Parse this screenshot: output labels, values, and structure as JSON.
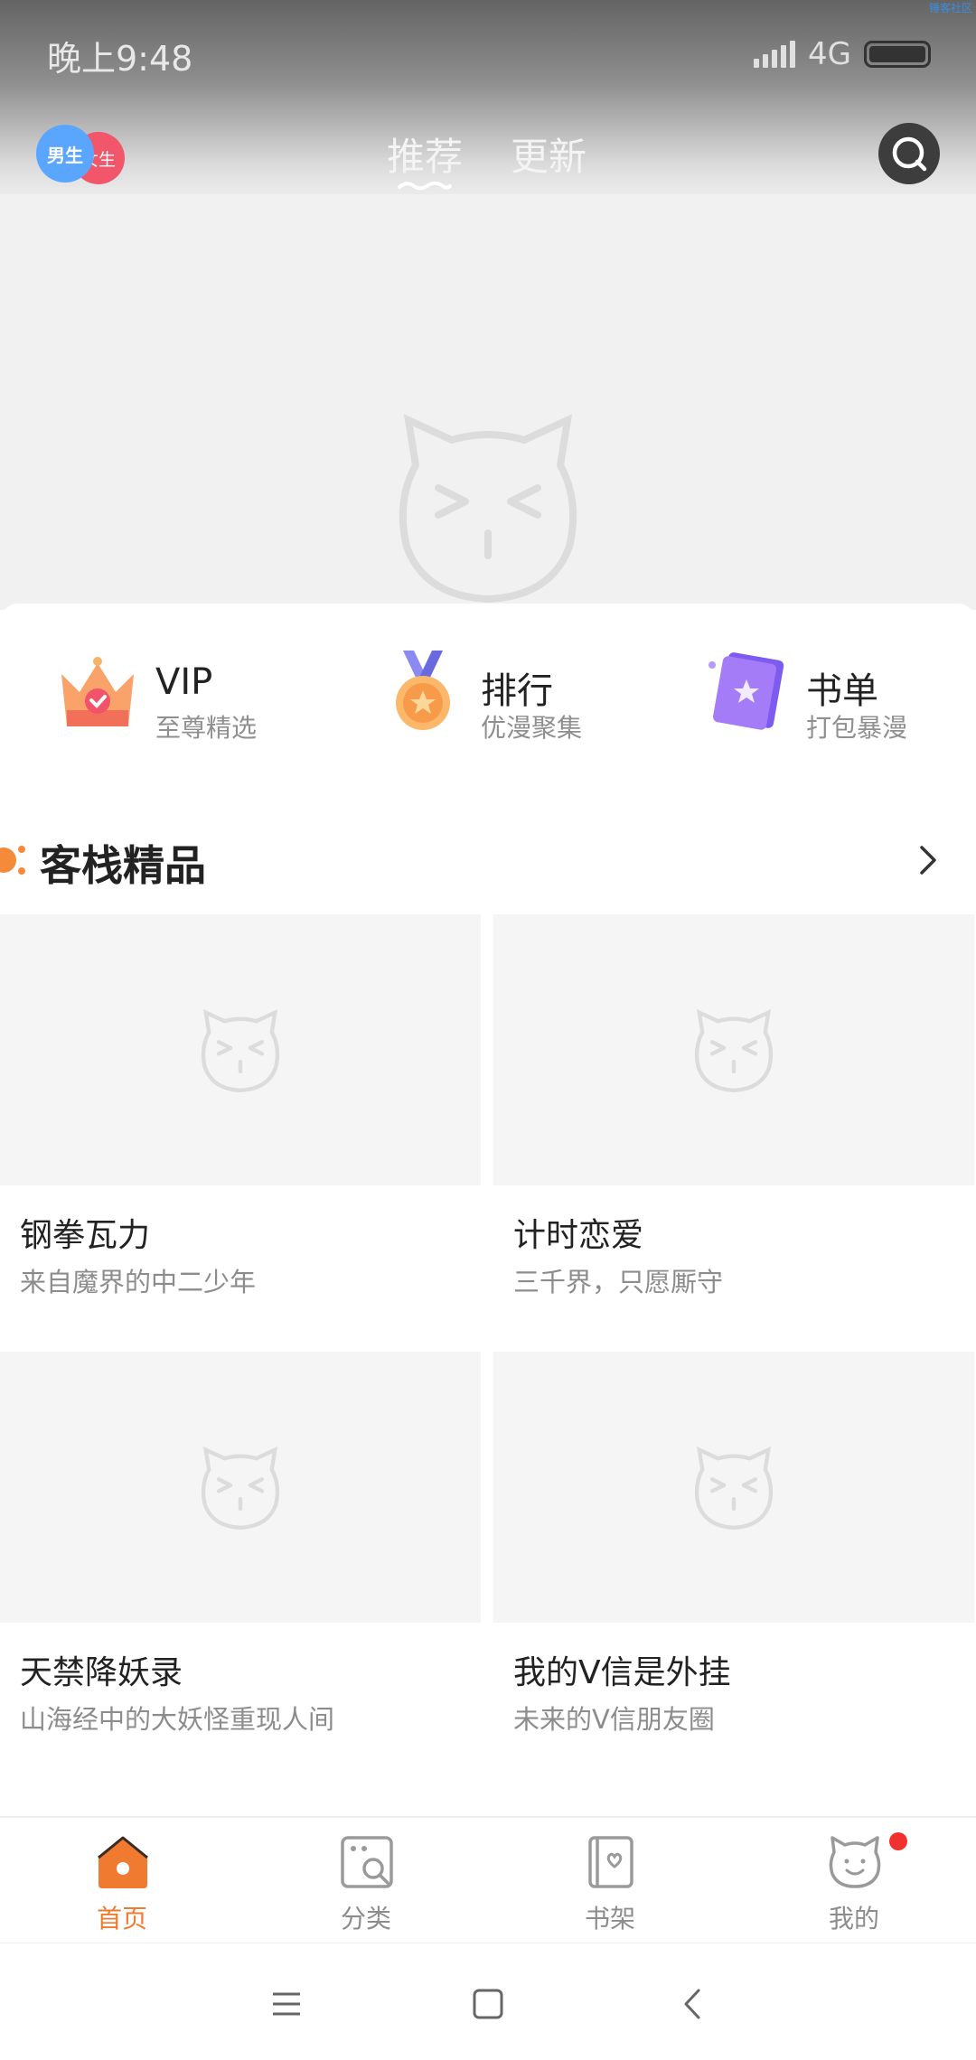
{
  "status_bar": {
    "time": "晚上9:48",
    "network": "4G",
    "watermark": "锤客社区"
  },
  "top_nav": {
    "gender_male": "男生",
    "gender_female": "女生",
    "tabs": [
      {
        "label": "推荐",
        "active": true
      },
      {
        "label": "更新",
        "active": false
      }
    ],
    "search_icon": "search-icon"
  },
  "banner": {
    "page_count": 5,
    "active_index": 1
  },
  "shortcuts": [
    {
      "title": "VIP",
      "subtitle": "至尊精选",
      "icon": "crown-icon"
    },
    {
      "title": "排行",
      "subtitle": "优漫聚集",
      "icon": "medal-icon"
    },
    {
      "title": "书单",
      "subtitle": "打包暴漫",
      "icon": "book-icon"
    }
  ],
  "section": {
    "title": "客栈精品",
    "more_icon": "chevron-right-icon"
  },
  "items": [
    {
      "title": "钢拳瓦力",
      "subtitle": "来自魔界的中二少年"
    },
    {
      "title": "计时恋爱",
      "subtitle": "三千界，只愿厮守"
    },
    {
      "title": "天禁降妖录",
      "subtitle": "山海经中的大妖怪重现人间"
    },
    {
      "title": "我的V信是外挂",
      "subtitle": "未来的V信朋友圈"
    }
  ],
  "bottom_nav": [
    {
      "label": "首页",
      "icon": "home-icon",
      "active": true
    },
    {
      "label": "分类",
      "icon": "category-icon",
      "active": false
    },
    {
      "label": "书架",
      "icon": "bookshelf-icon",
      "active": false
    },
    {
      "label": "我的",
      "icon": "profile-icon",
      "active": false,
      "badge": true
    }
  ],
  "colors": {
    "accent": "#f07a30",
    "badge": "#f0312e",
    "placeholder": "#f5f5f5"
  }
}
